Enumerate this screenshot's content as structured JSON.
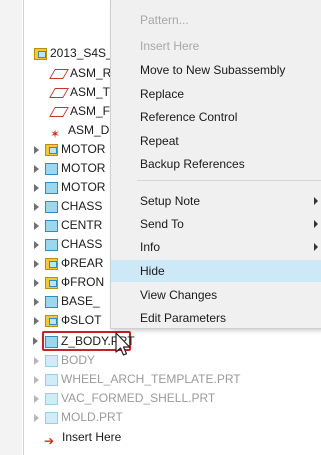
{
  "tree": {
    "root_label": "2013_S4S_",
    "items": [
      {
        "label": "ASM_R",
        "icon": "datum-plane-icon",
        "state": "normal"
      },
      {
        "label": "ASM_T",
        "icon": "datum-plane-icon",
        "state": "normal"
      },
      {
        "label": "ASM_F",
        "icon": "datum-plane-icon",
        "state": "normal"
      },
      {
        "label": "ASM_D",
        "icon": "coordinate-system-icon",
        "state": "normal"
      },
      {
        "label": "MOTOR",
        "icon": "assembly-icon",
        "state": "normal"
      },
      {
        "label": "MOTOR",
        "icon": "part-icon",
        "state": "normal"
      },
      {
        "label": "MOTOR",
        "icon": "part-icon",
        "state": "normal"
      },
      {
        "label": "CHASS",
        "icon": "part-icon",
        "state": "normal"
      },
      {
        "label": "CENTR",
        "icon": "part-icon",
        "state": "normal"
      },
      {
        "label": "CHASS",
        "icon": "part-icon",
        "state": "normal"
      },
      {
        "label": "ФREAR",
        "icon": "assembly-icon",
        "state": "normal"
      },
      {
        "label": "ФFRON",
        "icon": "assembly-icon",
        "state": "normal"
      },
      {
        "label": "BASE_",
        "icon": "part-icon",
        "state": "normal"
      },
      {
        "label": "ФSLOT",
        "icon": "assembly-icon",
        "state": "normal"
      },
      {
        "label": "Z_BODY.PRT",
        "icon": "part-icon",
        "state": "selected"
      },
      {
        "label": "BODY",
        "icon": "part-icon",
        "state": "dimmed"
      },
      {
        "label": "WHEEL_ARCH_TEMPLATE.PRT",
        "icon": "part-icon",
        "state": "dimmed"
      },
      {
        "label": "VAC_FORMED_SHELL.PRT",
        "icon": "part-icon",
        "state": "dimmed"
      },
      {
        "label": "MOLD.PRT",
        "icon": "part-icon",
        "state": "dimmed"
      },
      {
        "label": "Insert Here",
        "icon": "insert-arrow-icon",
        "state": "normal"
      }
    ]
  },
  "context_menu": {
    "items": [
      {
        "label": "Pattern...",
        "disabled": true
      },
      {
        "label": "Insert Here",
        "disabled": true
      },
      {
        "label": "Move to New Subassembly"
      },
      {
        "label": "Replace"
      },
      {
        "label": "Reference Control"
      },
      {
        "label": "Repeat"
      },
      {
        "label": "Backup References"
      },
      {
        "label": "Setup Note",
        "submenu": true
      },
      {
        "label": "Send To",
        "submenu": true
      },
      {
        "label": "Info",
        "submenu": true
      },
      {
        "label": "Hide",
        "highlighted": true
      },
      {
        "label": "View Changes"
      },
      {
        "label": "Edit Parameters"
      }
    ]
  },
  "colors": {
    "selection_outline": "#c8202a",
    "menu_highlight": "#cde8f7",
    "menu_background": "#f0f0f0"
  }
}
